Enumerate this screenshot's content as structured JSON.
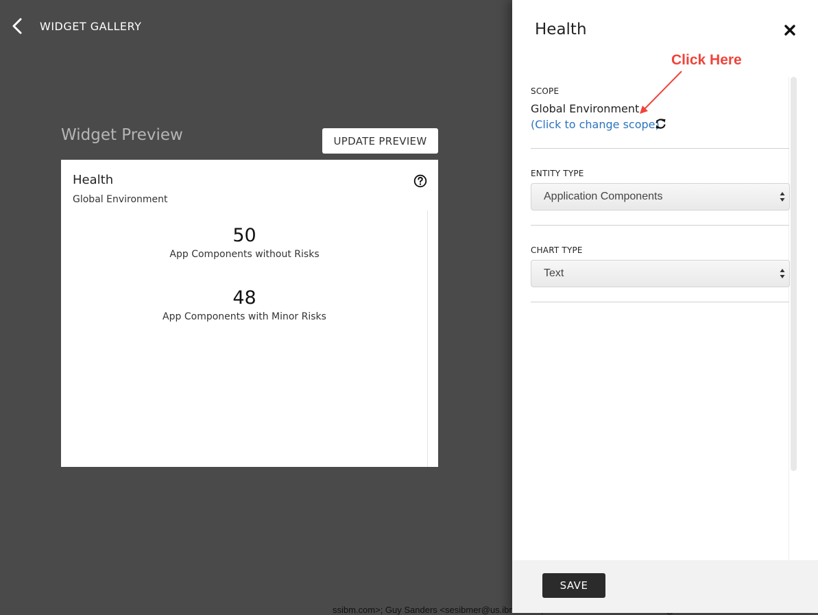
{
  "header": {
    "title": "WIDGET GALLERY",
    "back_icon": "chevron-left-icon"
  },
  "preview": {
    "title": "Widget Preview",
    "update_button": "UPDATE PREVIEW",
    "widget": {
      "title": "Health",
      "subtitle": "Global Environment",
      "help_icon": "question-circle-icon",
      "metrics": [
        {
          "value": "50",
          "label": "App Components without Risks"
        },
        {
          "value": "48",
          "label": "App Components with Minor Risks"
        }
      ]
    }
  },
  "bottom_text": "ssibm.com>; Guy Sanders <sesibmer@us.ibm.com>; Michael Marshall Jr <mrmarsh@us.ibm.co",
  "panel": {
    "title": "Health",
    "close_icon": "close-icon",
    "annotation": "Click Here",
    "annotation_color": "#f0433a",
    "scope": {
      "label": "SCOPE",
      "value": "Global Environment",
      "link": "(Click to change scope)",
      "link_color": "#2a74c0",
      "icon": "refresh-icon"
    },
    "entity_type": {
      "label": "ENTITY TYPE",
      "selected": "Application Components"
    },
    "chart_type": {
      "label": "CHART TYPE",
      "selected": "Text"
    },
    "save_button": "SAVE"
  }
}
